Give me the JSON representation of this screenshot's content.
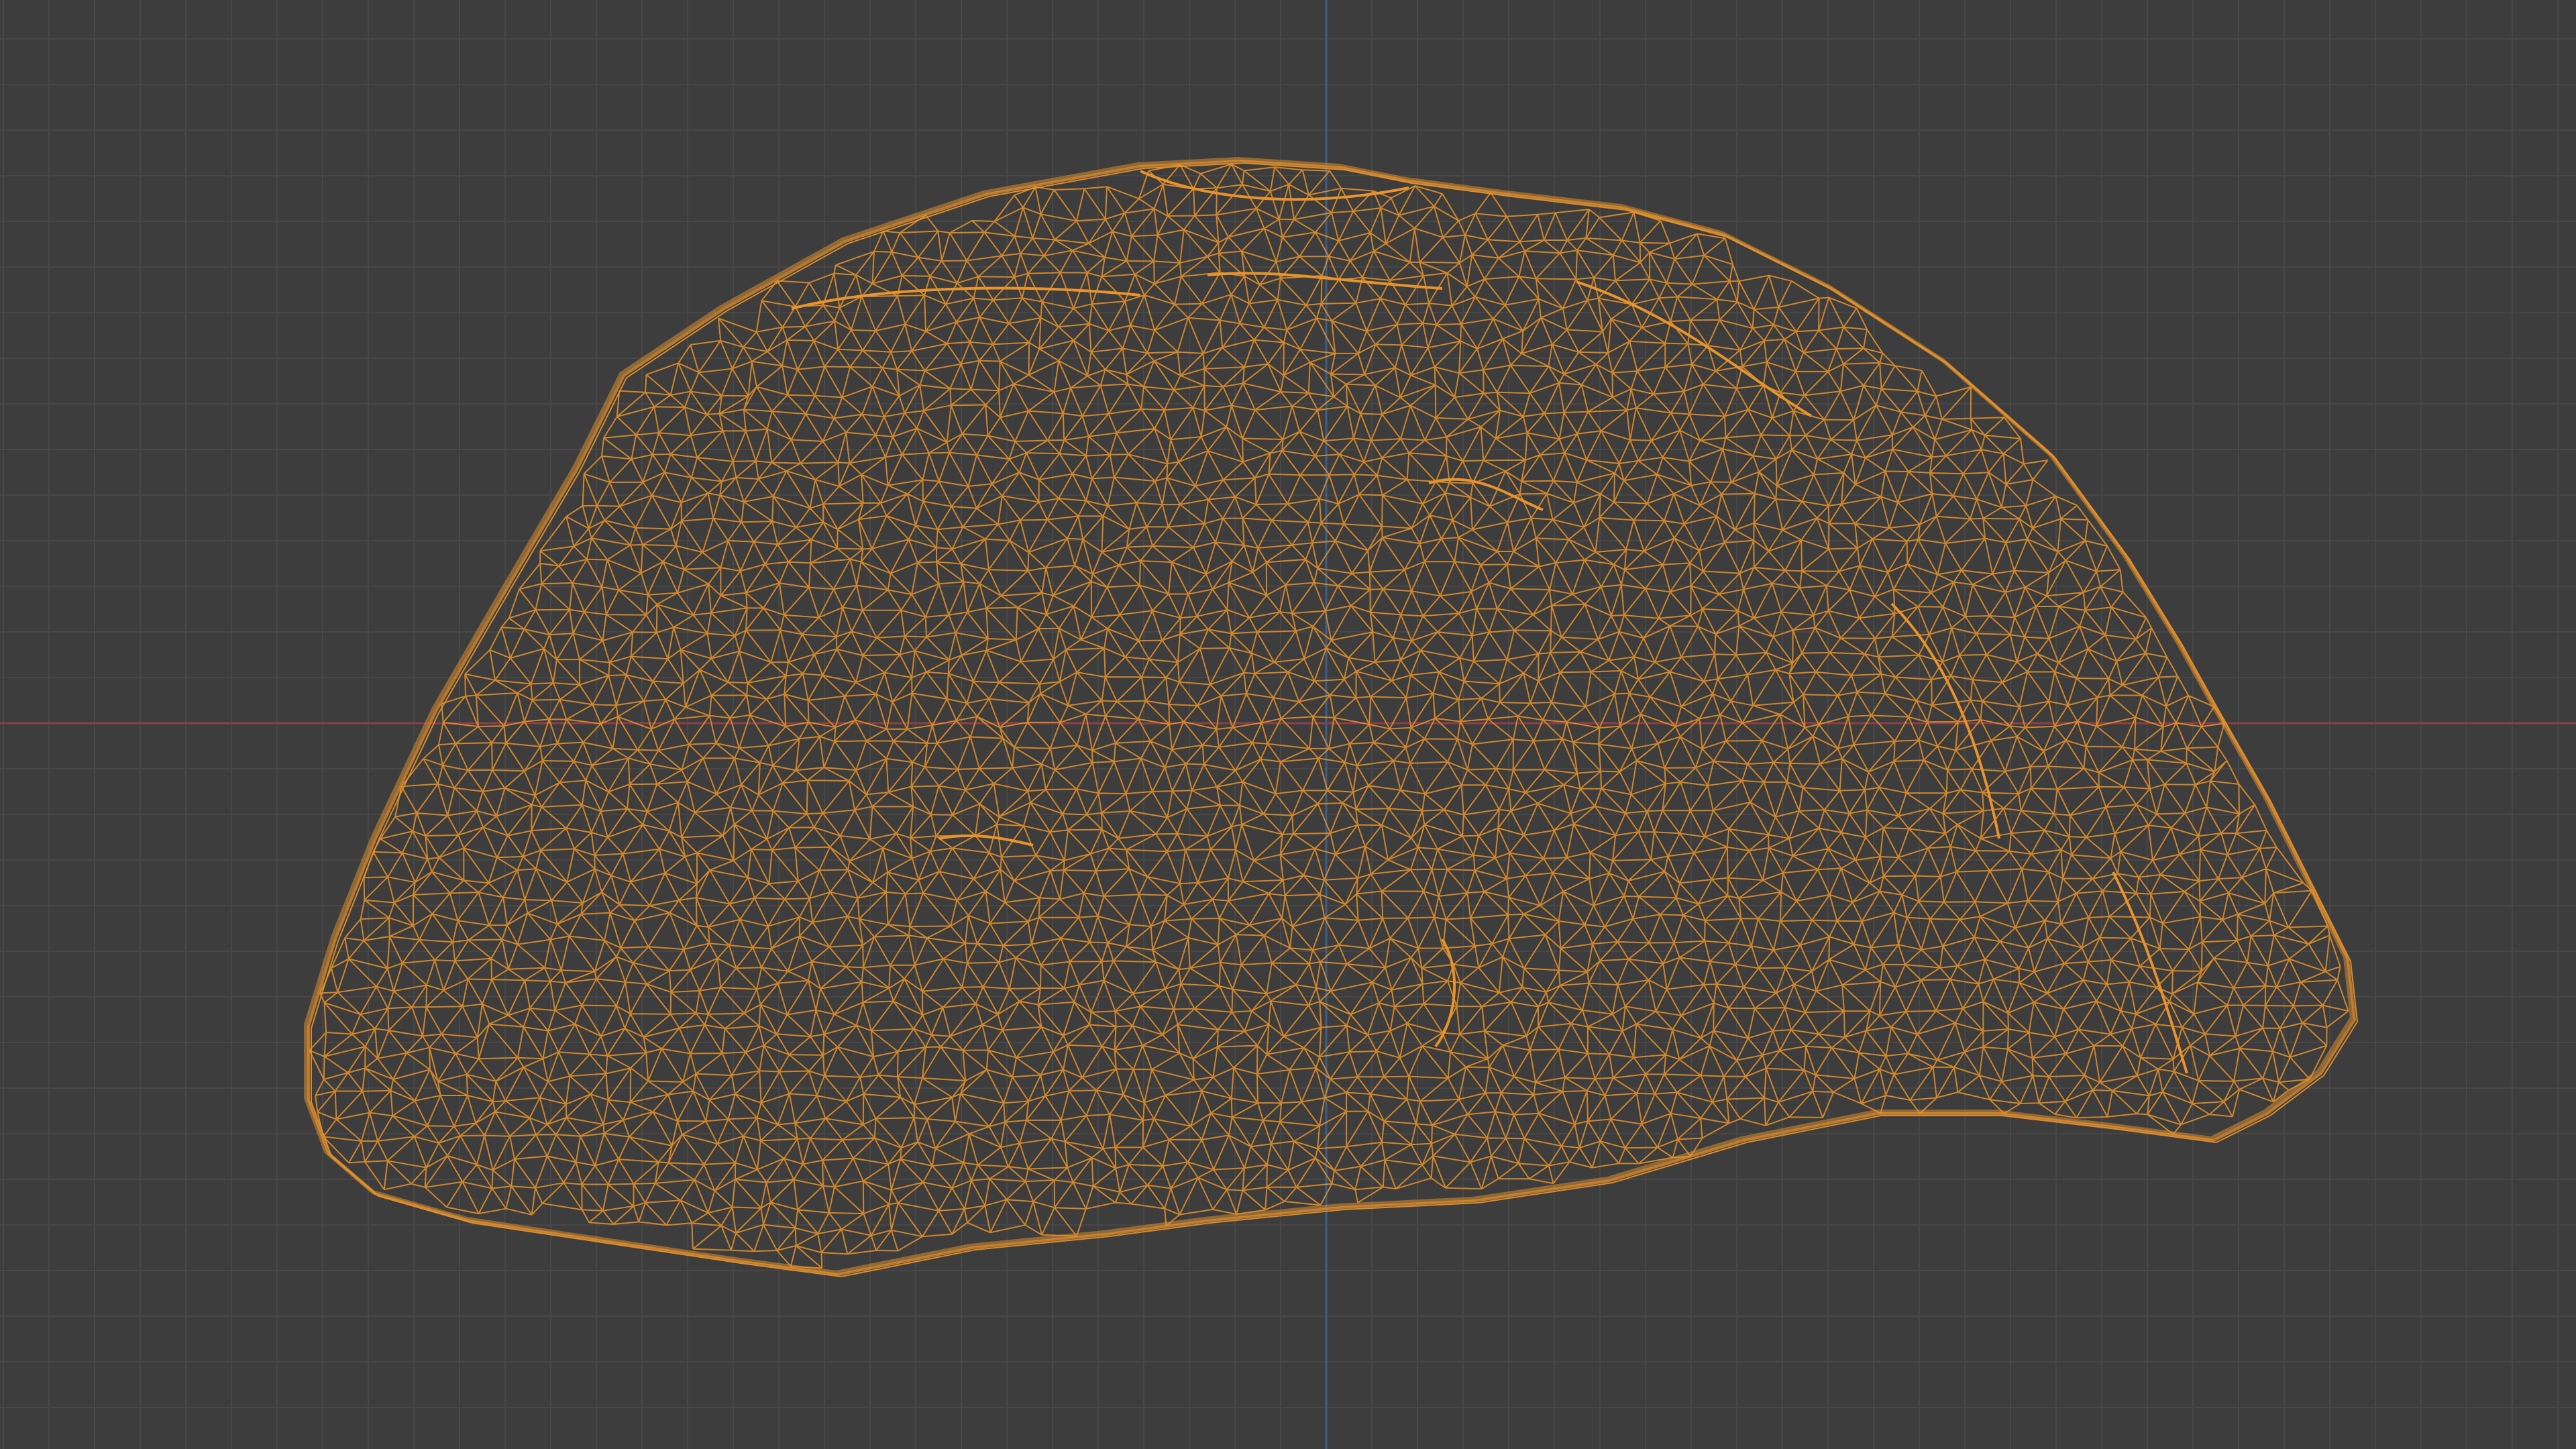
{
  "viewport": {
    "background_color": "#3d3d3d",
    "grid_color": "#474747",
    "x_axis_color": "#8a3f49",
    "y_axis_color": "#3d5f87",
    "wire_color": "#e8932c",
    "view": "orthographic",
    "shading": "wireframe"
  },
  "object": {
    "kind": "scanned rock mesh",
    "selected": true
  }
}
